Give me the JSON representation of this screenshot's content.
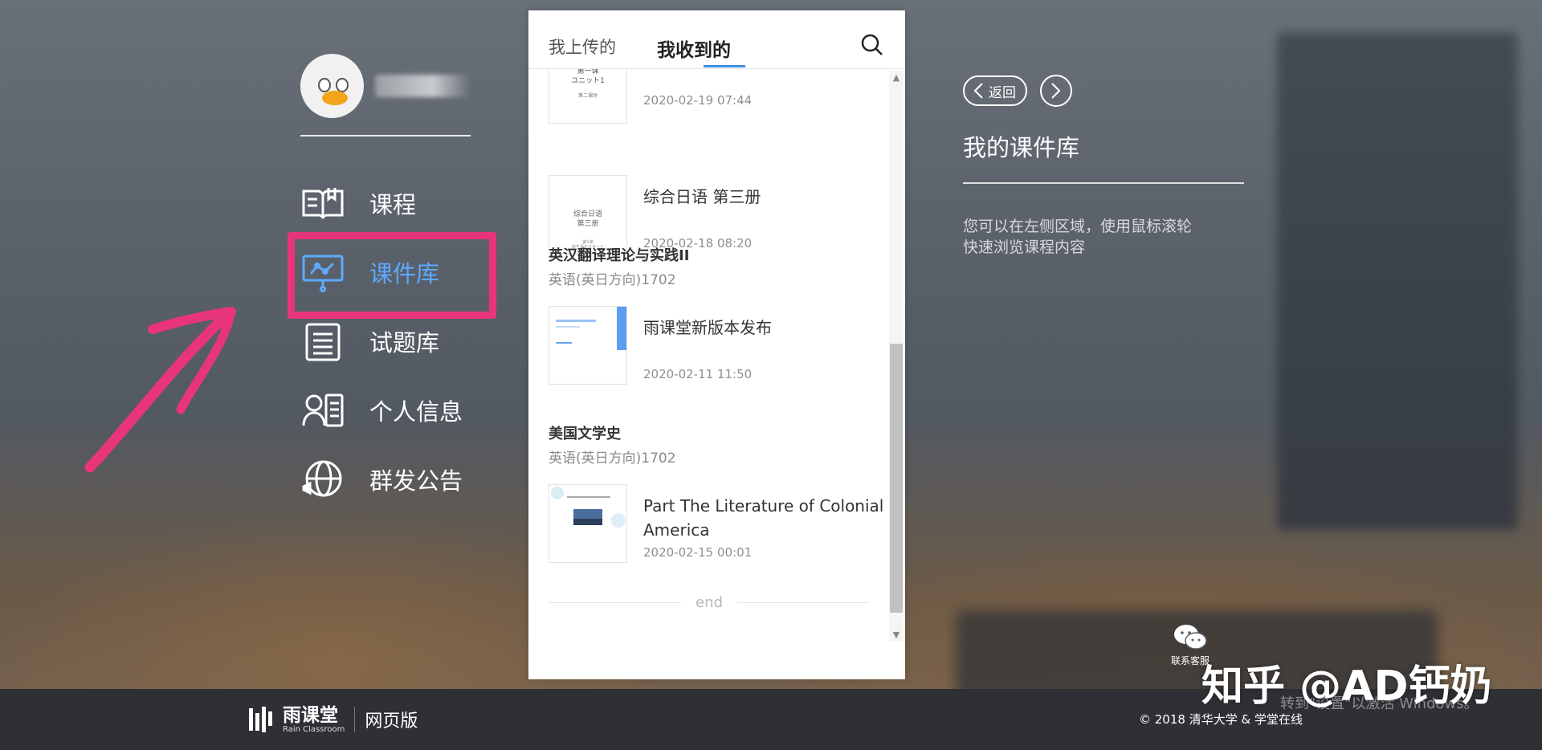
{
  "tabs": {
    "uploaded": "我上传的",
    "received": "我收到的"
  },
  "nav": {
    "items": [
      {
        "label": "课程",
        "icon": "book-icon"
      },
      {
        "label": "课件库",
        "icon": "presentation-icon"
      },
      {
        "label": "试题库",
        "icon": "list-icon"
      },
      {
        "label": "个人信息",
        "icon": "person-icon"
      },
      {
        "label": "群发公告",
        "icon": "globe-megaphone-icon"
      }
    ],
    "active": "课件库"
  },
  "list": {
    "items": [
      {
        "thumb_text": "第一课 ユニット1",
        "date": "2020-02-19 07:44"
      },
      {
        "title": "综合日语 第三册",
        "thumb_text": "综合日语 第三册",
        "date": "2020-02-18 08:20"
      },
      {
        "title": "雨课堂新版本发布",
        "date": "2020-02-11 11:50"
      },
      {
        "title": "Part The Literature of Colonial America",
        "date": "2020-02-15 00:01"
      }
    ],
    "groups": [
      {
        "title": "英汉翻译理论与实践II",
        "sub": "英语(英日方向)1702"
      },
      {
        "title": "美国文学史",
        "sub": "英语(英日方向)1702"
      }
    ],
    "end": "end"
  },
  "right": {
    "back": "返回",
    "title": "我的课件库",
    "desc_line1": "您可以在左侧区域，使用鼠标滚轮",
    "desc_line2": "快速浏览课程内容"
  },
  "footer": {
    "brand": "雨课堂",
    "brand_en": "Rain Classroom",
    "web": "网页版",
    "copyright": "© 2018 清华大学 & 学堂在线"
  },
  "service_label": "联系客服",
  "watermark": "知乎 @AD钙奶",
  "activate": "转到\"设置\"以激活 Windows。",
  "colors": {
    "accent": "#3d8ee8",
    "highlight": "#e8357a",
    "active_nav": "#5ea9ff"
  }
}
